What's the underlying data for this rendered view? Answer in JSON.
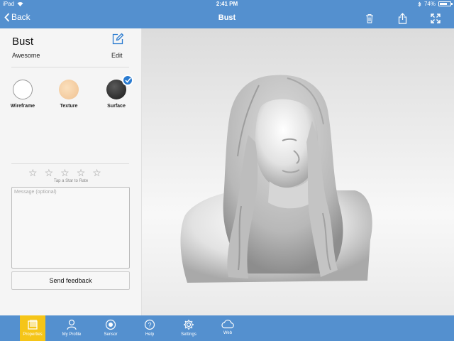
{
  "statusbar": {
    "device": "iPad",
    "time": "2:41 PM",
    "battery": "74%",
    "battery_level": 0.74
  },
  "navbar": {
    "back_label": "Back",
    "title": "Bust"
  },
  "model": {
    "title": "Bust",
    "subtitle": "Awesome",
    "edit_label": "Edit"
  },
  "render_modes": [
    {
      "label": "Wireframe",
      "selected": false
    },
    {
      "label": "Texture",
      "selected": false
    },
    {
      "label": "Surface",
      "selected": true
    }
  ],
  "rating": {
    "stars": 5,
    "value": 0,
    "hint": "Tap a Star to Rate"
  },
  "feedback": {
    "placeholder": "Message (optional)",
    "send_label": "Send feedback"
  },
  "tabs": [
    {
      "label": "Properties",
      "icon": "properties-icon",
      "active": true
    },
    {
      "label": "My Profile",
      "icon": "profile-icon",
      "active": false
    },
    {
      "label": "Sensor",
      "icon": "sensor-icon",
      "active": false
    },
    {
      "label": "Help",
      "icon": "help-icon",
      "active": false
    },
    {
      "label": "Settings",
      "icon": "gear-icon",
      "active": false
    },
    {
      "label": "Web",
      "icon": "cloud-icon",
      "active": false
    }
  ],
  "colors": {
    "brand": "#5490cf",
    "active_tab": "#f5c518",
    "check": "#2a7bd0"
  }
}
